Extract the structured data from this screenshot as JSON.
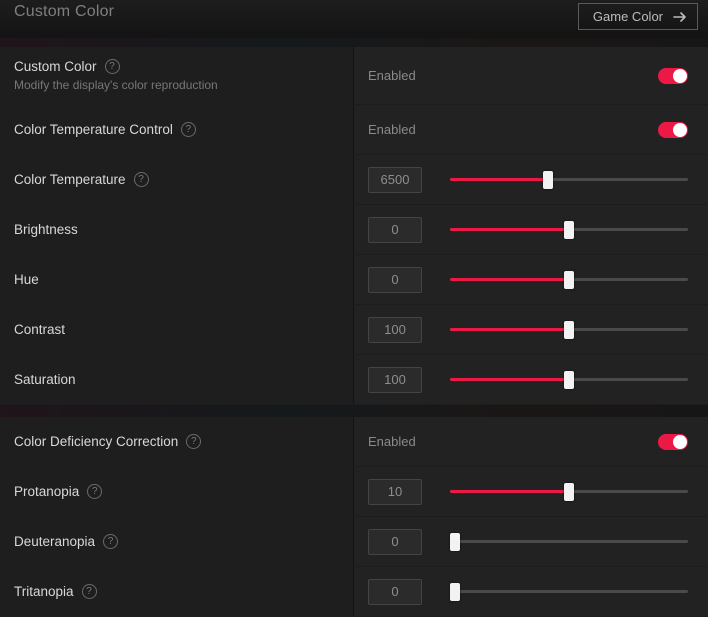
{
  "header": {
    "title": "Custom Color",
    "nav_button": "Game Color"
  },
  "status": {
    "enabled": "Enabled"
  },
  "rows": {
    "customColor": {
      "label": "Custom Color",
      "sub": "Modify the display's color reproduction"
    },
    "tempControl": {
      "label": "Color Temperature Control"
    },
    "temperature": {
      "label": "Color Temperature",
      "value": "6500",
      "fill": 41
    },
    "brightness": {
      "label": "Brightness",
      "value": "0",
      "fill": 50
    },
    "hue": {
      "label": "Hue",
      "value": "0",
      "fill": 50
    },
    "contrast": {
      "label": "Contrast",
      "value": "100",
      "fill": 50
    },
    "saturation": {
      "label": "Saturation",
      "value": "100",
      "fill": 50
    },
    "deficiency": {
      "label": "Color Deficiency Correction"
    },
    "protanopia": {
      "label": "Protanopia",
      "value": "10",
      "fill": 50
    },
    "deuteranopia": {
      "label": "Deuteranopia",
      "value": "0",
      "fill": 2
    },
    "tritanopia": {
      "label": "Tritanopia",
      "value": "0",
      "fill": 2
    }
  },
  "colors": {
    "accent": "#ec1846"
  },
  "chart_data": {
    "type": "table",
    "title": "Custom Color settings",
    "series": [
      {
        "name": "Custom Color",
        "value": "Enabled"
      },
      {
        "name": "Color Temperature Control",
        "value": "Enabled"
      },
      {
        "name": "Color Temperature",
        "value": 6500
      },
      {
        "name": "Brightness",
        "value": 0
      },
      {
        "name": "Hue",
        "value": 0
      },
      {
        "name": "Contrast",
        "value": 100
      },
      {
        "name": "Saturation",
        "value": 100
      },
      {
        "name": "Color Deficiency Correction",
        "value": "Enabled"
      },
      {
        "name": "Protanopia",
        "value": 10
      },
      {
        "name": "Deuteranopia",
        "value": 0
      },
      {
        "name": "Tritanopia",
        "value": 0
      }
    ]
  }
}
